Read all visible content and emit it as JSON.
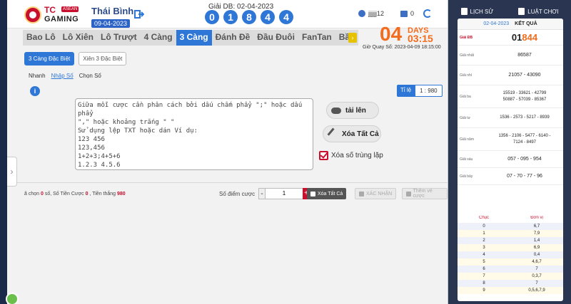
{
  "header": {
    "logo_tc": "TC",
    "logo_asean": "ASEAN",
    "logo_gaming": "GAMING",
    "region": "Thái Bình",
    "region_date": "09-04-2023",
    "giai_db_label": "Giải DB: 02-04-2023",
    "digits": [
      "0",
      "1",
      "8",
      "4",
      "4"
    ],
    "username": "jjjjjj12",
    "balance": "0"
  },
  "tabs": [
    "Bao Lô",
    "Lô Xiên",
    "Lô Trượt",
    "4 Càng",
    "3 Càng",
    "Đánh Đề",
    "Đầu Đuôi",
    "FanTan",
    "Bầu"
  ],
  "active_tab": "3 Càng",
  "countdown": {
    "days": "04",
    "days_label": "DAYS",
    "time": "03:15",
    "draw_time": "Giờ Quay Số: 2023-04-09 18:15:00"
  },
  "subtabs": [
    "3 Càng Đặc Biệt",
    "Xiên 3 Đặc Biệt"
  ],
  "modes": [
    "Nhanh",
    "Nhập Số",
    "Chọn Số"
  ],
  "ratio": {
    "key": "Tỉ lệ",
    "value": "1 : 980"
  },
  "textarea_placeholder": "Giữa mỗi cược cần phân cách bởi dấu chấm phẩy \";\" hoặc dấu\nphẩy\n\",\" hoặc khoảng trắng \" \"\nSử dụng lệp TXT hoặc dán Ví dụ:\n123 456\n123,456\n1+2+3;4+5+6\n1.2.3 4.5.6",
  "buttons": {
    "upload": "tải lên",
    "clear_all": "Xóa Tất Cả",
    "dedupe": "Xóa số trùng lặp",
    "clear_small": "Xóa Tất Cả",
    "confirm": "XÁC NHẬN",
    "add_bet": "Thêm vé cược"
  },
  "summary": {
    "selected_prefix": "ã chọn",
    "selected_count": "0",
    "selected_suffix": "số,",
    "bet_count_label": "Số Tiền Cược",
    "bet_count": "0",
    "win_label": ", Tiền thắng",
    "win_value": "980"
  },
  "points_label": "Số điểm cược",
  "stepper_value": "1",
  "right_panel": {
    "history": "LỊCH SỬ",
    "rules": "LUẬT CHƠI",
    "date": "02-04-2023",
    "result_title": "KẾT QUẢ",
    "results": [
      {
        "label": "Giải ĐB",
        "value_a": "01",
        "value_b": "844"
      },
      {
        "label": "Giải nhất",
        "value": "86587"
      },
      {
        "label": "Giải nhì",
        "value": "21057 - 43090"
      },
      {
        "label": "Giải ba",
        "value": "15519 - 33621 - 42799\n50887 - 57039 - 85367"
      },
      {
        "label": "Giải tư",
        "value": "1536 - 2573 - 5217 - 8939"
      },
      {
        "label": "Giải năm",
        "value": "1356 - 2106 - 5477 - 6140 -\n7124 - 8497"
      },
      {
        "label": "Giải sáu",
        "value": "057 - 095 - 954"
      },
      {
        "label": "Giải bảy",
        "value": "07 - 70 - 77 - 96"
      }
    ],
    "table_headers": [
      "Chục",
      "Đơn vị"
    ],
    "table_rows": [
      [
        "0",
        "6,7"
      ],
      [
        "1",
        "7,9"
      ],
      [
        "2",
        "1,4"
      ],
      [
        "3",
        "6,9"
      ],
      [
        "4",
        "0,4"
      ],
      [
        "5",
        "4,6,7"
      ],
      [
        "6",
        "7"
      ],
      [
        "7",
        "0,3,7"
      ],
      [
        "8",
        "7"
      ],
      [
        "9",
        "0,5,6,7,9"
      ]
    ]
  }
}
